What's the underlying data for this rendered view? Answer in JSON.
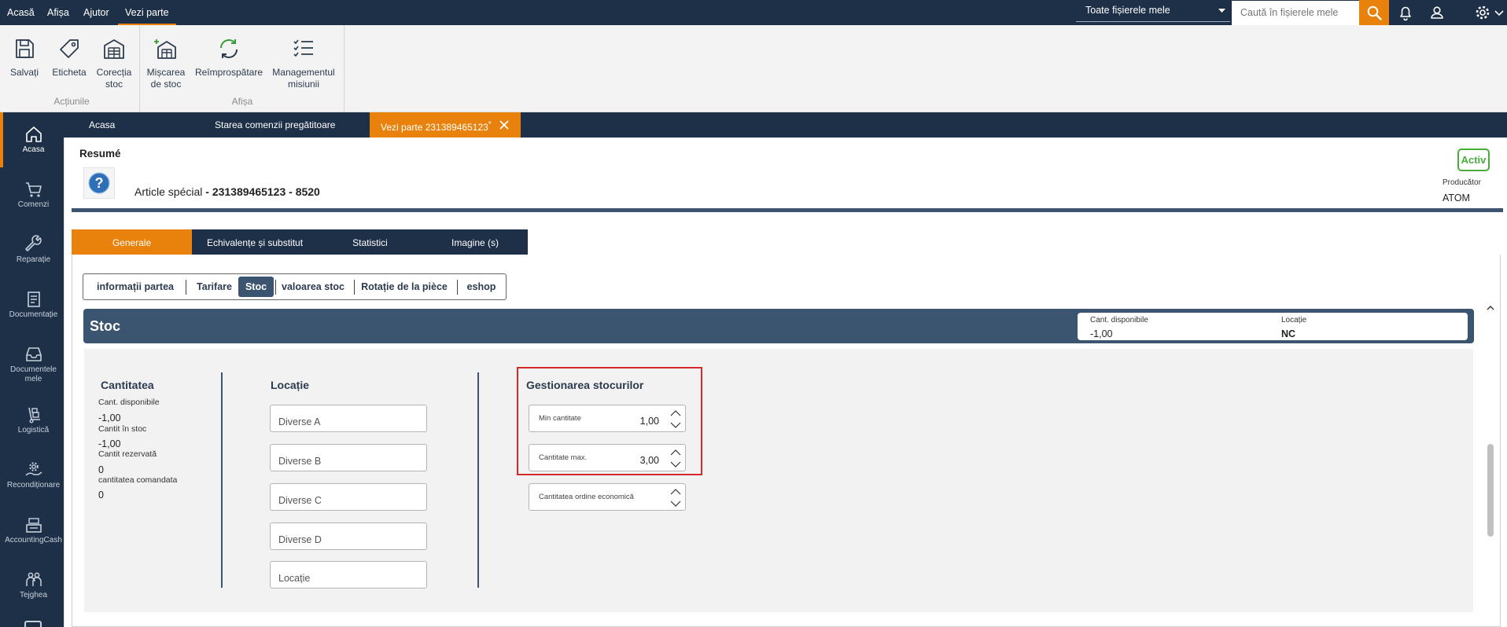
{
  "topbar": {
    "menus": [
      "Acasă",
      "Afișa",
      "Ajutor",
      "Vezi parte"
    ],
    "scope_select": "Toate fișierele mele",
    "search_placeholder": "Caută în fișierele mele"
  },
  "ribbon": {
    "groups": [
      {
        "label": "Acțiunile",
        "buttons": [
          "Salvați",
          "Eticheta",
          "Corecția\nstoc"
        ]
      },
      {
        "label": "Afișa",
        "buttons": [
          "Mișcarea\nde stoc",
          "Reîmprospătare",
          "Managementul\nmisiunii"
        ]
      }
    ]
  },
  "sidebar": {
    "items": [
      "Acasa",
      "Comenzi",
      "Reparație",
      "Documentație",
      "Documentele\nmele",
      "Logistică",
      "Recondiționare",
      "AccountingCash",
      "Tejghea"
    ]
  },
  "doc_tabs": [
    {
      "label": "Acasa"
    },
    {
      "label": "Starea comenzii pregătitoare"
    },
    {
      "label": "Vezi parte 231389465123",
      "modified_mark": "*"
    }
  ],
  "summary": {
    "title": "Resumé",
    "article_name": "Article spécial",
    "article_code": " - 231389465123 - 8520",
    "status": "Activ",
    "producer_label": "Producător",
    "producer_value": "ATOM"
  },
  "main_tabs": [
    "Generale",
    "Echivalențe și substitut",
    "Statistici",
    "Imagine (s)"
  ],
  "sub_tabs": [
    "informații partea",
    "Tarifare",
    "Stoc",
    "valoarea stoc",
    "Rotație de la pièce",
    "eshop"
  ],
  "stoc": {
    "title": "Stoc",
    "header_info": {
      "available_label": "Cant. disponibile",
      "available_value": "-1,00",
      "location_label": "Locație",
      "location_value": "NC"
    },
    "quantity": {
      "title": "Cantitatea",
      "rows": [
        {
          "label": "Cant. disponibile",
          "value": "-1,00"
        },
        {
          "label": "Cantit în stoc",
          "value": "-1,00"
        },
        {
          "label": "Cantit rezervată",
          "value": "0"
        },
        {
          "label": "cantitatea comandata",
          "value": "0"
        }
      ]
    },
    "location": {
      "title": "Locație",
      "fields": [
        "Diverse A",
        "Diverse B",
        "Diverse C",
        "Diverse D",
        "Locație"
      ]
    },
    "management": {
      "title": "Gestionarea stocurilor",
      "fields": [
        {
          "label": "Min cantitate",
          "value": "1,00"
        },
        {
          "label": "Cantitate max.",
          "value": "3,00"
        },
        {
          "label": "Cantitatea ordine economică",
          "value": ""
        }
      ]
    }
  },
  "colors": {
    "navy": "#1e3048",
    "slate": "#3b5470",
    "accent": "#e8820c",
    "active_green": "#4aaa3c",
    "highlight_red": "#d42a2a"
  }
}
